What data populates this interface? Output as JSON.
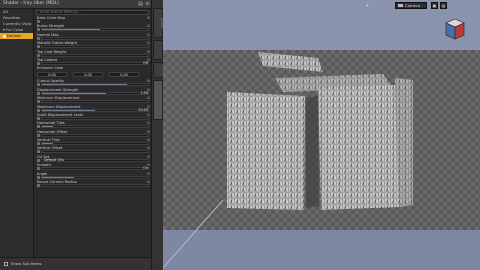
{
  "panel": {
    "title": "Shader - Iray Uber (MDL)",
    "controls": [
      "▤",
      "≡",
      "×"
    ]
  },
  "categories": [
    {
      "label": "All",
      "selected": false
    },
    {
      "label": "Favorites",
      "selected": false
    },
    {
      "label": "Currently Used",
      "selected": false
    },
    {
      "label": "▾ Fur Cube",
      "selected": false
    },
    {
      "label": "Default",
      "selected": true
    }
  ],
  "search": {
    "placeholder": "Enter text to filter by..."
  },
  "params": [
    {
      "label": "Base Color Map",
      "type": "swatch"
    },
    {
      "label": "Bump Strength",
      "type": "bar",
      "value": "",
      "fill": 0.55
    },
    {
      "label": "Normal Map",
      "type": "bar",
      "value": "",
      "fill": 0
    },
    {
      "label": "Metallic Flakes Weight",
      "type": "bar",
      "value": "",
      "fill": 0
    },
    {
      "label": "Top Coat Weight",
      "type": "bar",
      "value": "",
      "fill": 0
    },
    {
      "label": "Top Coated",
      "type": "bar",
      "value": "Off",
      "fill": 0
    },
    {
      "label": "Emission Color",
      "type": "coords",
      "coords": [
        "0.00",
        "0.00",
        "0.00"
      ]
    },
    {
      "label": "Cutout Opacity",
      "type": "bar",
      "value": "",
      "fill": 0.8
    },
    {
      "label": "Displacement Strength",
      "type": "bar",
      "value": "1.00",
      "fill": 0.6
    },
    {
      "label": "Minimum Displacement",
      "type": "bar",
      "value": "",
      "fill": 0
    },
    {
      "label": "Maximum Displacement",
      "type": "bar",
      "value": "10.00",
      "fill": 0.5
    },
    {
      "label": "SubD Displacement Level",
      "type": "bar",
      "value": "",
      "fill": 0
    },
    {
      "label": "Horizontal Tiles",
      "type": "bar",
      "value": "",
      "fill": 0.1
    },
    {
      "label": "Horizontal Offset",
      "type": "bar",
      "value": "",
      "fill": 0
    },
    {
      "label": "Vertical Tiles",
      "type": "bar",
      "value": "",
      "fill": 0.1
    },
    {
      "label": "Vertical Offset",
      "type": "bar",
      "value": "",
      "fill": 0
    },
    {
      "label": "UV Set",
      "type": "select",
      "value": "Default UVs"
    },
    {
      "label": "Smooth",
      "type": "bar",
      "value": "On",
      "fill": 0
    },
    {
      "label": "Angle",
      "type": "bar",
      "value": "",
      "fill": 0.3
    },
    {
      "label": "Round Corners Radius",
      "type": "bar",
      "value": "",
      "fill": 0
    }
  ],
  "vtabs": [
    {
      "label": "Scene",
      "active": false
    },
    {
      "label": "Scene Info",
      "active": false
    },
    {
      "label": "Render",
      "active": false
    },
    {
      "label": "Surfaces",
      "active": true
    }
  ],
  "footer": {
    "checkbox_label": "Show Sub Items"
  },
  "viewport": {
    "camera": "Camera",
    "pin": "⌖",
    "buttons": [
      "▣",
      "▤"
    ]
  }
}
